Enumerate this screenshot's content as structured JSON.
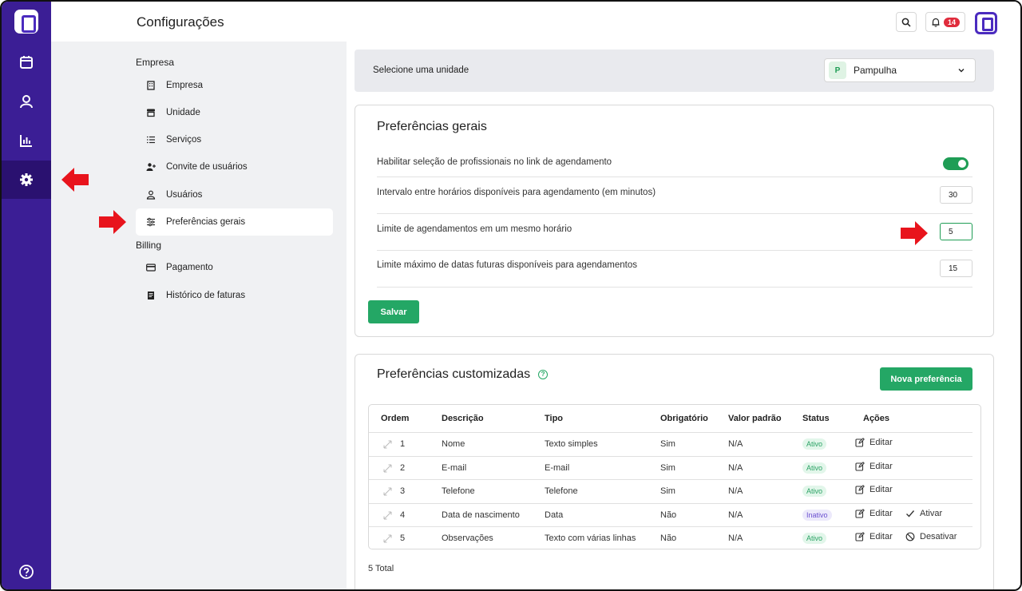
{
  "header": {
    "title": "Configurações",
    "notifications": "14"
  },
  "rail": {
    "items": [
      "calendar-icon",
      "user-icon",
      "chart-icon",
      "gear-icon",
      "help-icon"
    ]
  },
  "menu": {
    "section_company": "Empresa",
    "section_billing": "Billing",
    "items": [
      {
        "label": "Empresa",
        "icon": "building-icon"
      },
      {
        "label": "Unidade",
        "icon": "store-icon"
      },
      {
        "label": "Serviços",
        "icon": "list-icon"
      },
      {
        "label": "Convite de usuários",
        "icon": "user-plus-icon"
      },
      {
        "label": "Usuários",
        "icon": "user-icon"
      },
      {
        "label": "Preferências gerais",
        "icon": "sliders-icon"
      },
      {
        "label": "Pagamento",
        "icon": "card-icon"
      },
      {
        "label": "Histórico de faturas",
        "icon": "invoice-icon"
      }
    ]
  },
  "unit": {
    "label": "Selecione uma unidade",
    "avatar": "P",
    "selected": "Pampulha"
  },
  "general": {
    "title": "Preferências gerais",
    "rows": [
      {
        "text": "Habilitar seleção de profissionais no link de agendamento",
        "toggle": true
      },
      {
        "text": "Intervalo entre horários disponíveis para agendamento (em minutos)",
        "value": "30"
      },
      {
        "text": "Limite de agendamentos em um mesmo horário",
        "value": "5"
      },
      {
        "text": "Limite máximo de datas futuras disponíveis para agendamentos",
        "value": "15"
      }
    ],
    "save": "Salvar"
  },
  "custom": {
    "title": "Preferências customizadas",
    "help": "?",
    "new_button": "Nova preferência",
    "columns": [
      "Ordem",
      "Descrição",
      "Tipo",
      "Obrigatório",
      "Valor padrão",
      "Status",
      "Ações"
    ],
    "rows": [
      {
        "order": "1",
        "desc": "Nome",
        "type": "Texto simples",
        "req": "Sim",
        "def": "N/A",
        "status": "Ativo",
        "edit": "Editar",
        "extra": ""
      },
      {
        "order": "2",
        "desc": "E-mail",
        "type": "E-mail",
        "req": "Sim",
        "def": "N/A",
        "status": "Ativo",
        "edit": "Editar",
        "extra": ""
      },
      {
        "order": "3",
        "desc": "Telefone",
        "type": "Telefone",
        "req": "Sim",
        "def": "N/A",
        "status": "Ativo",
        "edit": "Editar",
        "extra": ""
      },
      {
        "order": "4",
        "desc": "Data de nascimento",
        "type": "Data",
        "req": "Não",
        "def": "N/A",
        "status": "Inativo",
        "edit": "Editar",
        "extra": "Ativar"
      },
      {
        "order": "5",
        "desc": "Observações",
        "type": "Texto com várias linhas",
        "req": "Não",
        "def": "N/A",
        "status": "Ativo",
        "edit": "Editar",
        "extra": "Desativar"
      }
    ],
    "total": "5 Total"
  },
  "colors": {
    "rail": "#3b1e95",
    "accent": "#24a765",
    "arrow": "#e8141c"
  }
}
